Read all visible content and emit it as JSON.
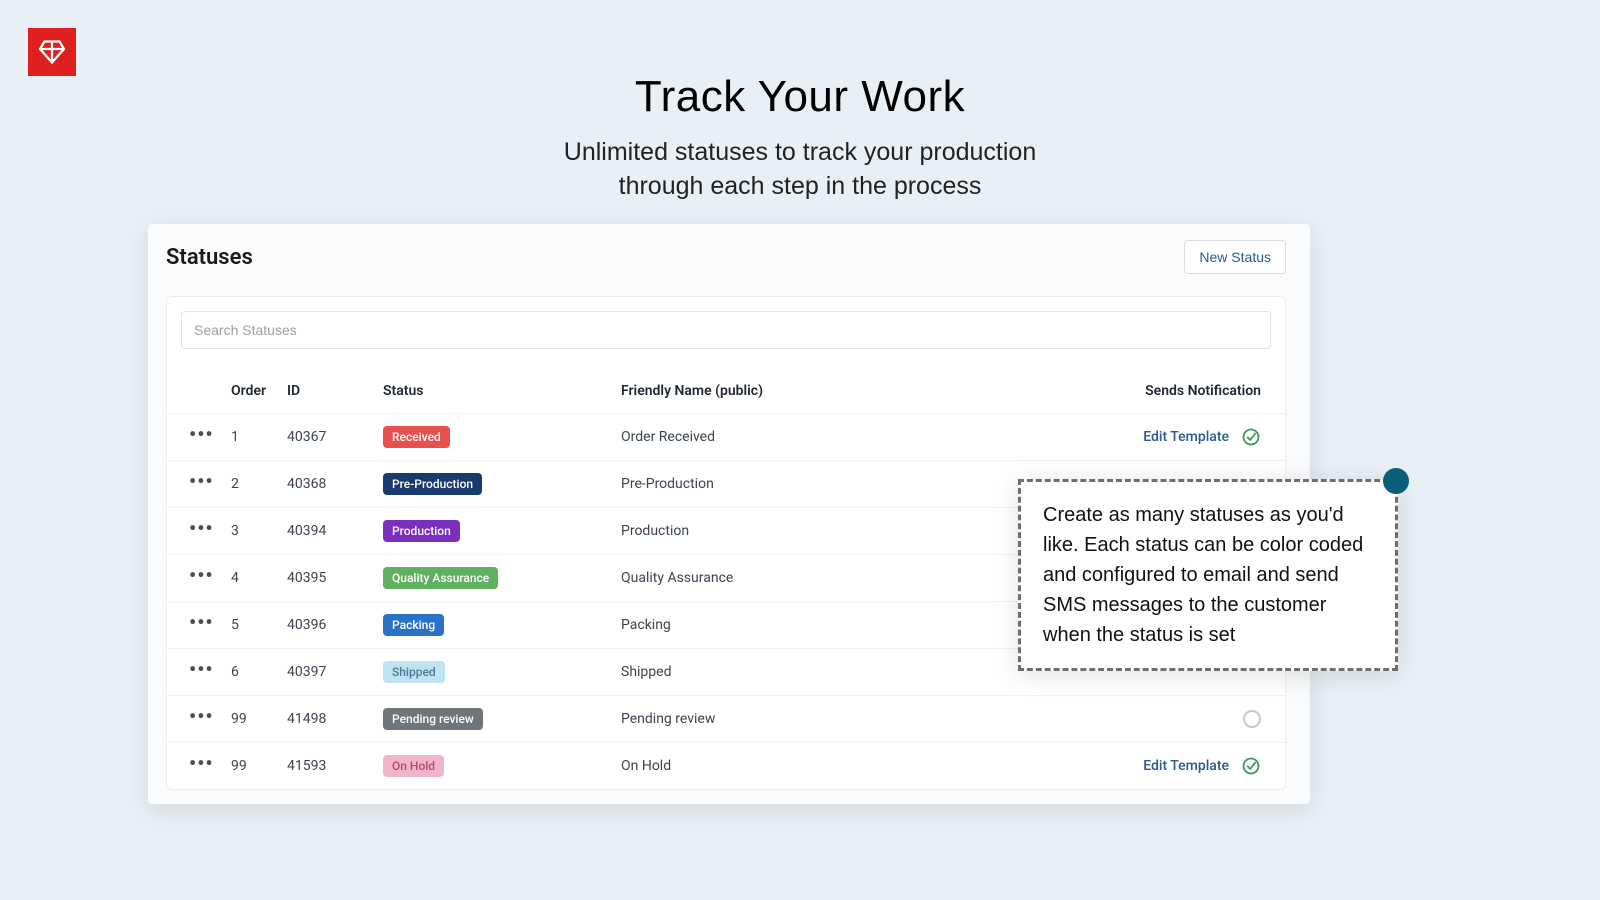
{
  "hero": {
    "title": "Track Your Work",
    "subtitle_line1": "Unlimited statuses to track your production",
    "subtitle_line2": "through each step in the process"
  },
  "panel": {
    "title": "Statuses",
    "new_button": "New Status",
    "search_placeholder": "Search Statuses"
  },
  "table": {
    "headers": {
      "order": "Order",
      "id": "ID",
      "status": "Status",
      "friendly": "Friendly Name (public)",
      "notif": "Sends Notification"
    },
    "edit_link": "Edit Template",
    "rows": [
      {
        "order": "1",
        "id": "40367",
        "status": "Received",
        "color": "#e85050",
        "text": "#fff",
        "friendly": "Order Received",
        "notif": "check"
      },
      {
        "order": "2",
        "id": "40368",
        "status": "Pre-Production",
        "color": "#1a3a6e",
        "text": "#fff",
        "friendly": "Pre-Production",
        "notif": "none"
      },
      {
        "order": "3",
        "id": "40394",
        "status": "Production",
        "color": "#7a2fbf",
        "text": "#fff",
        "friendly": "Production",
        "notif": "none"
      },
      {
        "order": "4",
        "id": "40395",
        "status": "Quality Assurance",
        "color": "#5fb05f",
        "text": "#fff",
        "friendly": "Quality Assurance",
        "notif": "none"
      },
      {
        "order": "5",
        "id": "40396",
        "status": "Packing",
        "color": "#2a72c8",
        "text": "#fff",
        "friendly": "Packing",
        "notif": "none"
      },
      {
        "order": "6",
        "id": "40397",
        "status": "Shipped",
        "color": "#bfe3f2",
        "text": "#4a7a95",
        "friendly": "Shipped",
        "notif": "none"
      },
      {
        "order": "99",
        "id": "41498",
        "status": "Pending review",
        "color": "#6e757b",
        "text": "#fff",
        "friendly": "Pending review",
        "notif": "circle"
      },
      {
        "order": "99",
        "id": "41593",
        "status": "On Hold",
        "color": "#f0b6c8",
        "text": "#b04a6a",
        "friendly": "On Hold",
        "notif": "check"
      }
    ]
  },
  "callout": {
    "text": "Create as many statuses as you'd like. Each status can be color coded and configured to email and send SMS messages to the customer when the status is set"
  }
}
